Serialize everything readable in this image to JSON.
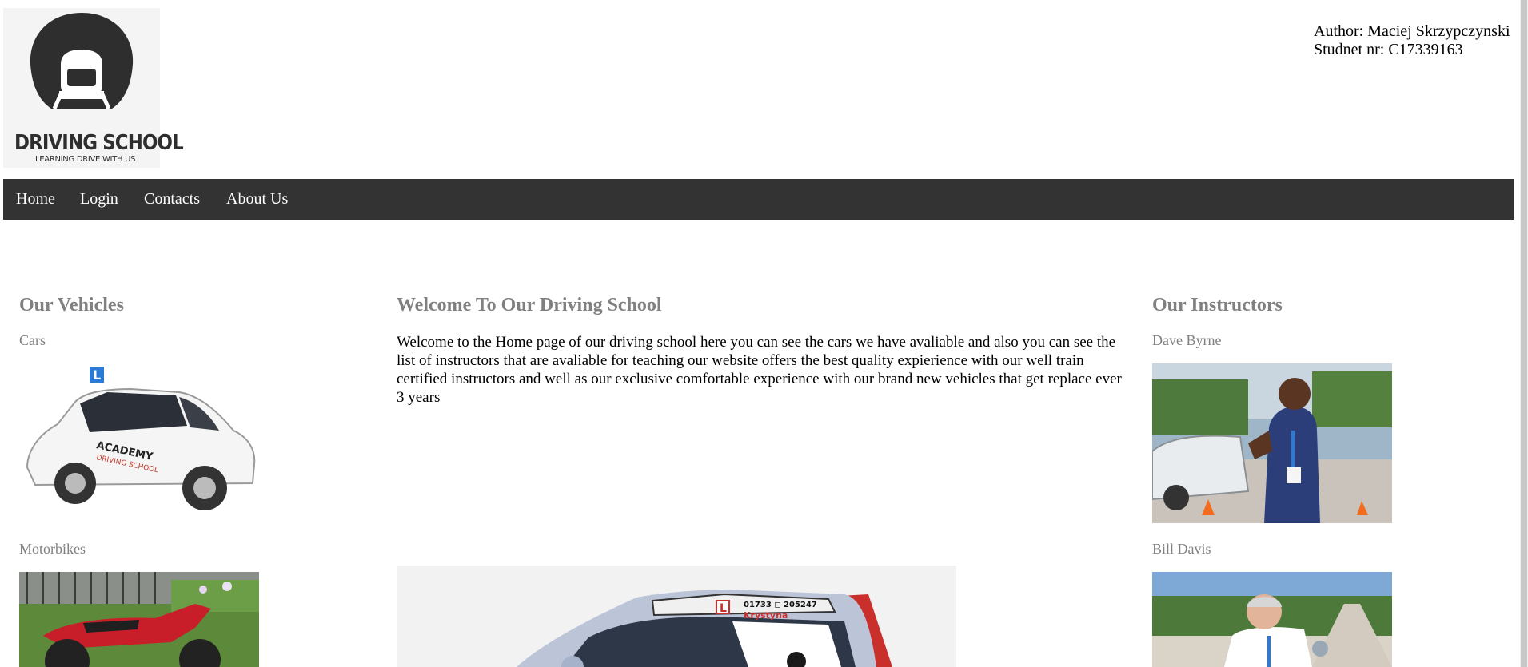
{
  "header": {
    "logo": {
      "title": "DRIVING SCHOOL",
      "tagline": "LEARNING DRIVE WITH US",
      "icon": "helmet-icon"
    },
    "author_line": "Author: Maciej Skrzypczynski",
    "student_line": "Studnet nr: C17339163"
  },
  "nav": {
    "items": [
      "Home",
      "Login",
      "Contacts",
      "About Us"
    ]
  },
  "vehicles": {
    "heading": "Our Vehicles",
    "cars_label": "Cars",
    "bikes_label": "Motorbikes",
    "car_decal_brand": "ACADEMY",
    "car_decal_sub": "DRIVING SCHOOL",
    "learner_plate": "L"
  },
  "welcome": {
    "heading": "Welcome To Our Driving School",
    "text": "Welcome to the Home page of our driving school here you can see the cars we have avaliable and also you can see the list of instructors that are avaliable for teaching our website offers the best quality expierience with our well train certified instructors and well as our exclusive comfortable experience with our brand new vehicles that get replace ever 3 years",
    "sign_plate": "L",
    "sign_phone": "01733 ◻ 205247",
    "sign_name": "Krystyna"
  },
  "instructors": {
    "heading": "Our Instructors",
    "names": [
      "Dave Byrne",
      "Bill Davis"
    ]
  },
  "colors": {
    "nav_bg": "#333333",
    "heading_grey": "#808080",
    "logo_dark": "#2e2e2e"
  }
}
